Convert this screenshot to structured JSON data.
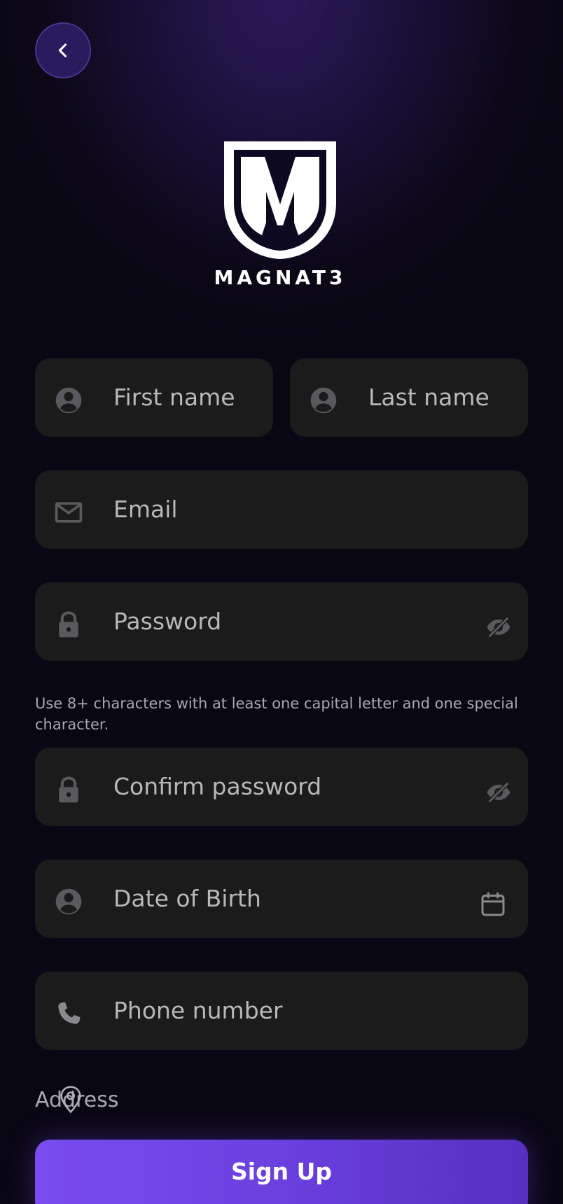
{
  "brand": {
    "name": "MAGNAT3"
  },
  "form": {
    "first_name_placeholder": "First name",
    "last_name_placeholder": "Last name",
    "email_placeholder": "Email",
    "password_placeholder": "Password",
    "password_hint": "Use 8+ characters with at least one capital letter and one special character.",
    "confirm_password_placeholder": "Confirm password",
    "dob_placeholder": "Date of Birth",
    "phone_placeholder": "Phone number",
    "address_label": "Address",
    "submit_label": "Sign Up"
  },
  "icons": {
    "back": "chevron-left-icon",
    "person": "account-circle-icon",
    "email": "envelope-icon",
    "lock": "lock-icon",
    "visibility": "eye-off-icon",
    "calendar": "calendar-icon",
    "phone": "phone-icon",
    "location": "location-pin-icon"
  },
  "colors": {
    "accent_start": "#7a4cf0",
    "accent_end": "#5530c0",
    "field_bg": "#1b1b1b",
    "icon_gray": "#5a5a5e"
  }
}
